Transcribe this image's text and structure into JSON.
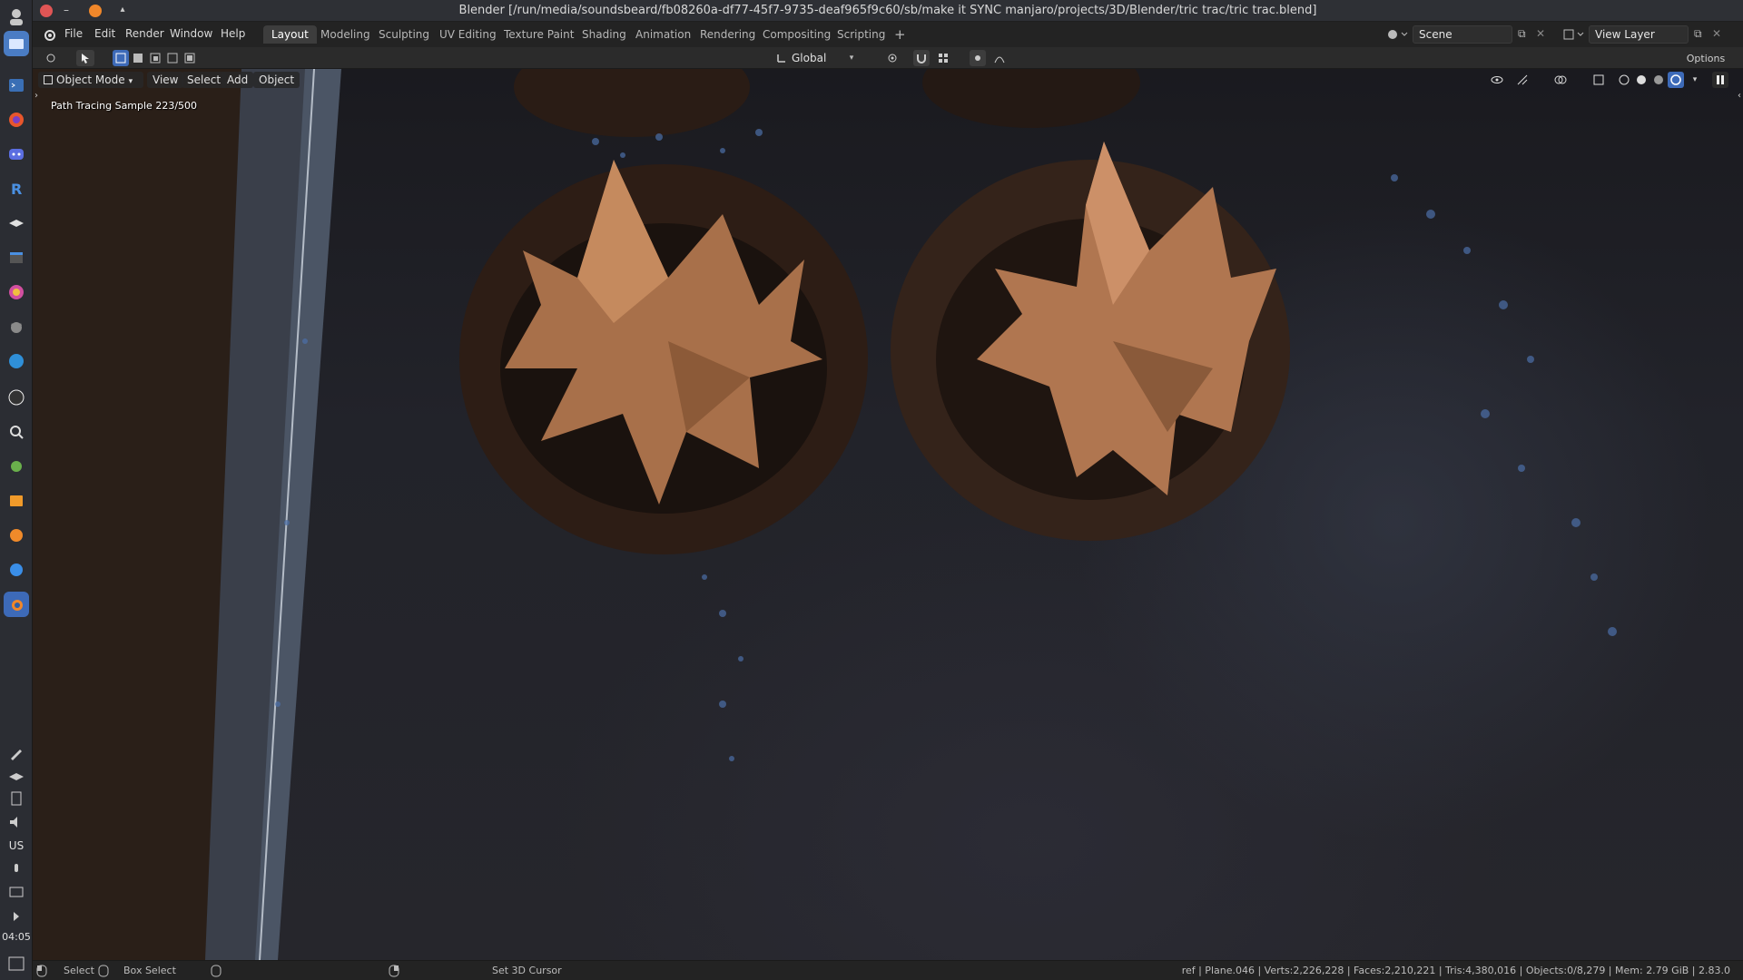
{
  "window": {
    "title": "Blender [/run/media/soundsbeard/fb08260a-df77-45f7-9735-deaf965f9c60/sb/make it SYNC manjaro/projects/3D/Blender/tric trac/tric trac.blend]"
  },
  "dock": {
    "items": [
      "avatar-icon",
      "folder-icon",
      "terminal-icon",
      "firefox-icon",
      "discord-icon",
      "r-icon",
      "layers-icon",
      "panel-icon",
      "color-icon",
      "cat-icon",
      "globe-icon",
      "obs-icon",
      "search-icon",
      "green-dot-icon",
      "files-icon",
      "orange-icon",
      "blue-icon",
      "blender-icon"
    ],
    "tray": [
      "pen-icon",
      "layers-icon",
      "clipboard-icon",
      "volume-icon",
      "mic-icon",
      "display-icon",
      "expand-icon"
    ],
    "language": "US",
    "clock": "04:05"
  },
  "menus": [
    "File",
    "Edit",
    "Render",
    "Window",
    "Help"
  ],
  "workspaces": [
    {
      "label": "Layout",
      "active": true
    },
    {
      "label": "Modeling",
      "active": false
    },
    {
      "label": "Sculpting",
      "active": false
    },
    {
      "label": "UV Editing",
      "active": false
    },
    {
      "label": "Texture Paint",
      "active": false
    },
    {
      "label": "Shading",
      "active": false
    },
    {
      "label": "Animation",
      "active": false
    },
    {
      "label": "Rendering",
      "active": false
    },
    {
      "label": "Compositing",
      "active": false
    },
    {
      "label": "Scripting",
      "active": false
    }
  ],
  "scene": {
    "name": "Scene"
  },
  "view_layer": {
    "name": "View Layer"
  },
  "toolheader": {
    "orientation": "Global",
    "options": "Options"
  },
  "viewport": {
    "mode": "Object Mode",
    "menus": [
      "View",
      "Select",
      "Add",
      "Object"
    ],
    "render_status": "Path Tracing Sample 223/500"
  },
  "statusbar": {
    "select": "Select",
    "box_select": "Box Select",
    "cursor": "Set 3D Cursor",
    "stats": "ref | Plane.046 | Verts:2,226,228 | Faces:2,210,221 | Tris:4,380,016 | Objects:0/8,279 | Mem: 2.79 GiB | 2.83.0"
  },
  "colors": {
    "accent": "#3d6ab8",
    "active_tab": "#3d3d3d",
    "header": "#232323",
    "wood": "#a0643c"
  }
}
